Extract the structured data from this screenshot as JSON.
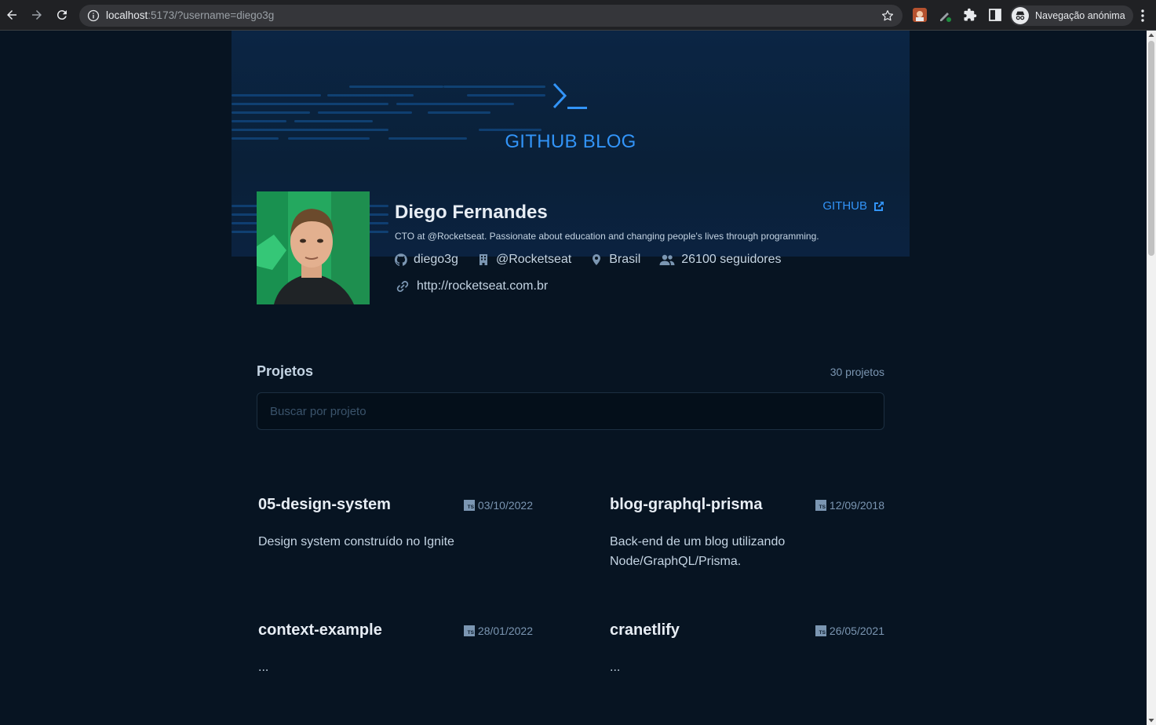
{
  "browser": {
    "url_host": "localhost",
    "url_rest": ":5173/?username=diego3g",
    "profile_label": "Navegação anónima"
  },
  "header": {
    "logo_text": "GITHUB BLOG"
  },
  "profile": {
    "name": "Diego Fernandes",
    "github_label": "GITHUB",
    "bio": "CTO at @Rocketseat. Passionate about education and changing people's lives through programming.",
    "username": "diego3g",
    "company": "@Rocketseat",
    "location": "Brasil",
    "followers": "26100 seguidores",
    "website": "http://rocketseat.com.br"
  },
  "projects": {
    "title": "Projetos",
    "count": "30 projetos",
    "search_placeholder": "Buscar por projeto",
    "items": [
      {
        "title": "05-design-system",
        "date": "03/10/2022",
        "description": "Design system construído no Ignite"
      },
      {
        "title": "blog-graphql-prisma",
        "date": "12/09/2018",
        "description": "Back-end de um blog utilizando Node/GraphQL/Prisma."
      },
      {
        "title": "context-example",
        "date": "28/01/2022",
        "description": "..."
      },
      {
        "title": "cranetlify",
        "date": "26/05/2021",
        "description": "..."
      }
    ]
  },
  "colors": {
    "accent": "#3294f8",
    "background": "#071422",
    "card_text": "#c4d4e3"
  }
}
